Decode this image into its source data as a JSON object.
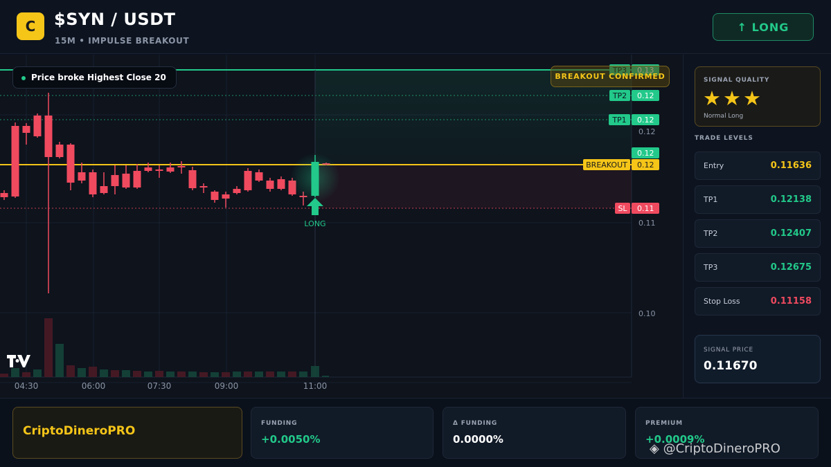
{
  "header": {
    "logo_letter": "C",
    "title": "$SYN / USDT",
    "subtitle": "15M • IMPULSE BREAKOUT",
    "signal_button": "↑ LONG"
  },
  "chart": {
    "indicator_label": "Price broke Highest Close 20",
    "confirm_badge": "BREAKOUT CONFIRMED",
    "signal_marker_label": "LONG",
    "watermark_logo": "TV",
    "x_ticks": [
      "04:30",
      "06:00",
      "07:30",
      "09:00",
      "11:00"
    ],
    "y_ticks": [
      "0.12",
      "0.11",
      "0.10"
    ],
    "level_tags": [
      {
        "label": "TP3",
        "value": "0.13"
      },
      {
        "label": "TP2",
        "value": "0.12"
      },
      {
        "label": "TP1",
        "value": "0.12"
      },
      {
        "label": "",
        "value": "0.12"
      },
      {
        "label": "BREAKOUT",
        "value": "0.12"
      },
      {
        "label": "SL",
        "value": "0.11"
      }
    ],
    "colors": {
      "up": "#22c98a",
      "down": "#f04a5f",
      "breakout": "#f5c518",
      "tp": "#22c98a",
      "sl": "#f04a5f"
    }
  },
  "panel": {
    "quality_label": "SIGNAL QUALITY",
    "stars": "★★★",
    "quality_sub": "Normal Long",
    "levels_title": "TRADE LEVELS",
    "levels": [
      {
        "name": "Entry",
        "value": "0.11636",
        "color": "#f5c518"
      },
      {
        "name": "TP1",
        "value": "0.12138",
        "color": "#22c98a"
      },
      {
        "name": "TP2",
        "value": "0.12407",
        "color": "#22c98a"
      },
      {
        "name": "TP3",
        "value": "0.12675",
        "color": "#22c98a"
      },
      {
        "name": "Stop Loss",
        "value": "0.11158",
        "color": "#f04a5f"
      }
    ],
    "signal_price_label": "SIGNAL PRICE",
    "signal_price": "0.11670"
  },
  "footer": {
    "brand": "CriptoDineroPRO",
    "funding_label": "FUNDING",
    "funding_value": "+0.0050%",
    "delta_label": "Δ FUNDING",
    "delta_value": "0.0000%",
    "premium_label": "PREMIUM",
    "premium_value": "+0.0009%",
    "watermark": "◈ @CriptoDineroPRO"
  }
}
